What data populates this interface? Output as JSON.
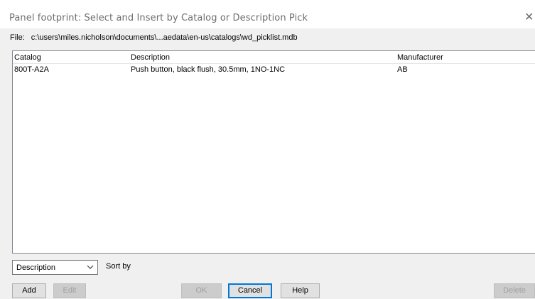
{
  "window": {
    "title": "Panel footprint: Select and Insert by Catalog or Description Pick",
    "close_glyph": "✕"
  },
  "file": {
    "label": "File:",
    "path": "c:\\users\\miles.nicholson\\documents\\...aedata\\en-us\\catalogs\\wd_picklist.mdb"
  },
  "table": {
    "columns": [
      "Catalog",
      "Description",
      "Manufacturer"
    ],
    "rows": [
      [
        "800T-A2A",
        "Push button, black flush, 30.5mm, 1NO-1NC",
        "AB"
      ]
    ]
  },
  "sort": {
    "selected": "Description",
    "label": "Sort by"
  },
  "buttons": {
    "add": "Add",
    "edit": "Edit",
    "ok": "OK",
    "cancel": "Cancel",
    "help": "Help",
    "delete": "Delete"
  },
  "icons": {
    "close": "close-icon",
    "dropdown": "chevron-down-icon"
  }
}
